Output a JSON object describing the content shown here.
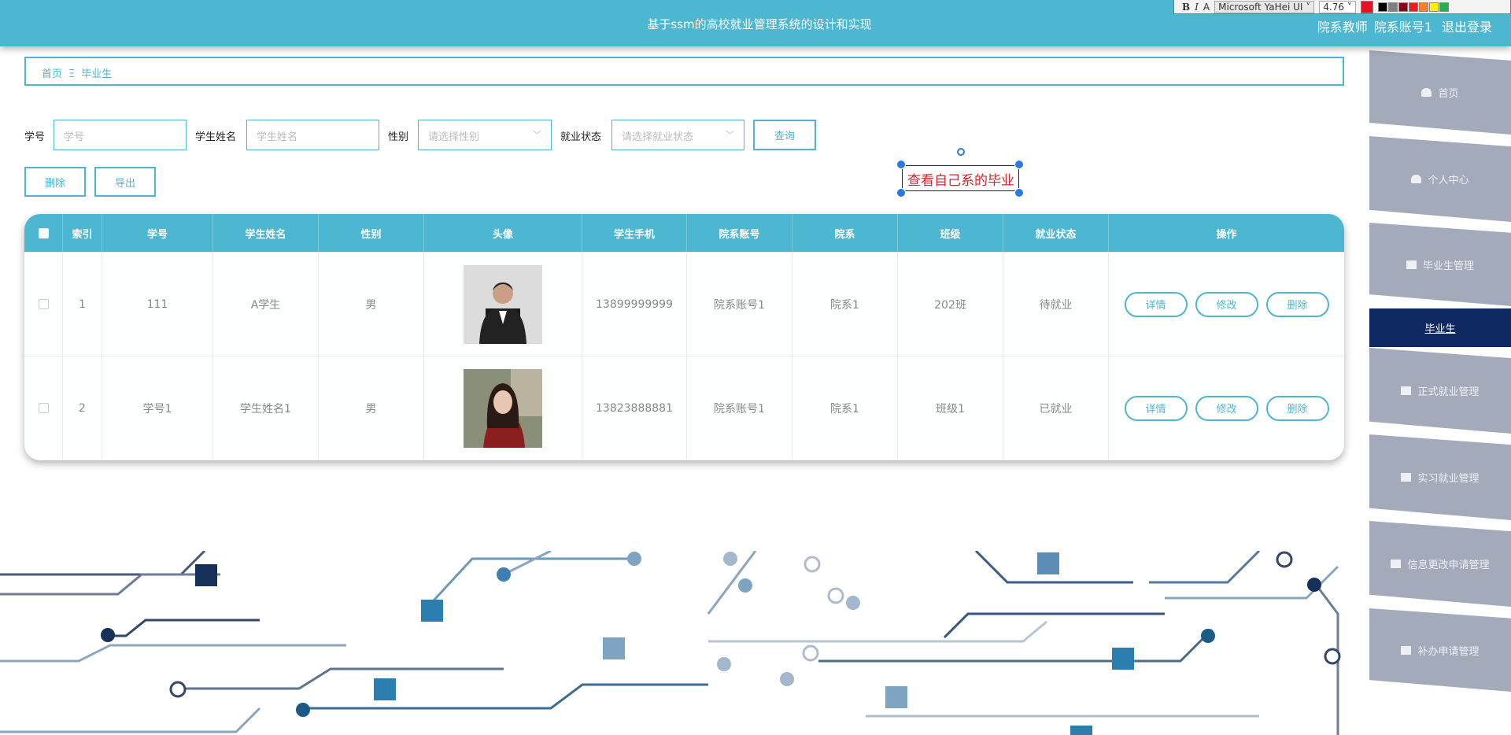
{
  "header": {
    "title": "基于ssm的高校就业管理系统的设计和实现",
    "role": "院系教师",
    "account": "院系账号1",
    "logout": "退出登录"
  },
  "toolbar": {
    "bold": "B",
    "italic": "I",
    "outline": "A",
    "font": "Microsoft YaHei UI",
    "size": "4.76",
    "colors": [
      "#e81123",
      "#000000",
      "#7f7f7f",
      "#880015",
      "#ed1c24",
      "#ff7f27",
      "#fff200",
      "#22b14c",
      "#ffffff",
      "#c3c3c3",
      "#b97a57",
      "#ffaec9",
      "#ffc90e",
      "#efe4b0",
      "#b5e61d"
    ]
  },
  "breadcrumb": {
    "home": "首页",
    "sep": "Ξ",
    "current": "毕业生"
  },
  "search": {
    "xuehao_label": "学号",
    "xuehao_placeholder": "学号",
    "name_label": "学生姓名",
    "name_placeholder": "学生姓名",
    "gender_label": "性别",
    "gender_placeholder": "请选择性别",
    "status_label": "就业状态",
    "status_placeholder": "请选择就业状态",
    "query": "查询"
  },
  "actions": {
    "delete": "删除",
    "export": "导出"
  },
  "annotation": "查看自己系的毕业",
  "table": {
    "headers": [
      "索引",
      "学号",
      "学生姓名",
      "性别",
      "头像",
      "学生手机",
      "院系账号",
      "院系",
      "班级",
      "就业状态",
      "操作"
    ],
    "rows": [
      {
        "index": "1",
        "xuehao": "111",
        "name": "A学生",
        "gender": "男",
        "phone": "13899999999",
        "account": "院系账号1",
        "dept": "院系1",
        "cls": "202班",
        "status": "待就业"
      },
      {
        "index": "2",
        "xuehao": "学号1",
        "name": "学生姓名1",
        "gender": "男",
        "phone": "13823888881",
        "account": "院系账号1",
        "dept": "院系1",
        "cls": "班级1",
        "status": "已就业"
      }
    ],
    "ops": {
      "detail": "详情",
      "edit": "修改",
      "delete": "删除"
    }
  },
  "sidebar": {
    "items": [
      {
        "label": "首页",
        "icon": "home-icon"
      },
      {
        "label": "个人中心",
        "icon": "user-icon"
      },
      {
        "label": "毕业生管理",
        "icon": "grid-icon"
      },
      {
        "label": "毕业生",
        "active": true
      },
      {
        "label": "正式就业管理",
        "icon": "monitor-icon"
      },
      {
        "label": "实习就业管理",
        "icon": "chat-icon"
      },
      {
        "label": "信息更改申请管理",
        "icon": "grid-icon"
      },
      {
        "label": "补办申请管理",
        "icon": "grid-icon"
      }
    ]
  }
}
